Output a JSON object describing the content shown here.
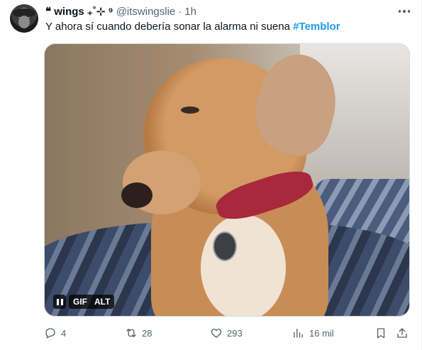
{
  "tweet": {
    "author_name": "❝ wings ₊˚⊹ ⁹",
    "handle": "@itswingslie",
    "separator": "·",
    "time": "1h",
    "text": "Y ahora sí cuando debería sonar la alarma ni suena ",
    "hashtag": "#Temblor"
  },
  "media": {
    "type": "gif",
    "gif_label": "GIF",
    "alt_label": "ALT"
  },
  "actions": {
    "replies": "4",
    "reposts": "28",
    "likes": "293",
    "views": "16 mil"
  },
  "icons": {
    "more": "more-dots-icon",
    "reply": "reply-icon",
    "repost": "repost-icon",
    "like": "like-icon",
    "views": "views-icon",
    "bookmark": "bookmark-icon",
    "share": "share-icon",
    "pause": "pause-icon"
  },
  "colors": {
    "hashtag": "#1d9bf0",
    "secondary_text": "#536471",
    "primary_text": "#0f1419"
  }
}
